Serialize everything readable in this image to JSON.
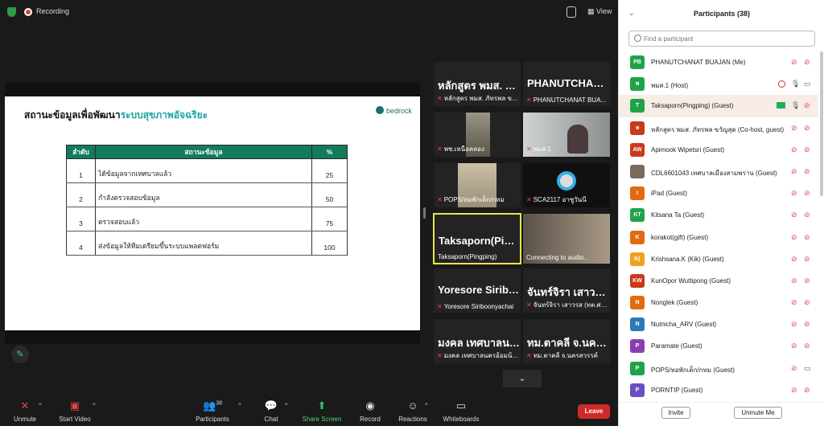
{
  "topbar": {
    "recording_label": "Recording",
    "view_label": "View"
  },
  "slide": {
    "title_black": "สถานะข้อมูลเพื่อพัฒนา",
    "title_teal": "ระบบสุขภาพอัจฉริยะ",
    "logo": "bedrock",
    "headers": [
      "ลำดับ",
      "สถานะข้อมูล",
      "%"
    ],
    "rows": [
      [
        "1",
        "ได้ข้อมูลจากเทศบาลแล้ว",
        "25"
      ],
      [
        "2",
        "กำลังตรวจสอบข้อมูล",
        "50"
      ],
      [
        "3",
        "ตรวจสอบแล้ว",
        "75"
      ],
      [
        "4",
        "ส่งข้อมูลให้ทีมเตรียมขึ้นระบบแพลตฟอร์ม",
        "100"
      ]
    ]
  },
  "tiles": [
    {
      "big": "หลักสูตร พมส. ภั...",
      "name": "หลักสูตร พมส. ภัทรพล ขา..."
    },
    {
      "big": "PHANUTCHAN...",
      "name": "PHANUTCHANAT BUA..."
    },
    {
      "big": "",
      "name": "พช.เหนือคลอง"
    },
    {
      "big": "",
      "name": "พมส.1"
    },
    {
      "big": "",
      "name": "POPS/หอพักเด็ก/กทม"
    },
    {
      "big": "",
      "name": "SCA2117 อาซูวันนี"
    },
    {
      "big": "Taksaporn(Ping...",
      "name": "Taksaporn(Pingping)"
    },
    {
      "big": "",
      "name": "Connecting to audio..."
    },
    {
      "big": "Yoresore Siribo...",
      "name": "Yoresore Siriboonyachai"
    },
    {
      "big": "จันทร์จิรา เสาวรส...",
      "name": "จันทร์จิรา เสาวรส (ทต.ศรีด..."
    },
    {
      "big": "มงคล เทศบาลนค...",
      "name": "มงคล เทศบาลนครอ้อมน้อย"
    },
    {
      "big": "ทม.ตาคลี จ.นครส...",
      "name": "ทม.ตาคลี จ.นครสวรรค์"
    }
  ],
  "toolbar": {
    "unmute": "Unmute",
    "start_video": "Start Video",
    "participants": "Participants",
    "participants_count": "38",
    "chat": "Chat",
    "share_screen": "Share Screen",
    "record": "Record",
    "reactions": "Reactions",
    "whiteboards": "Whiteboards",
    "leave": "Leave"
  },
  "panel": {
    "title": "Participants (38)",
    "search_placeholder": "Find a participant",
    "invite": "Invite",
    "unmute_me": "Unmute Me",
    "participants": [
      {
        "initials": "PB",
        "color": "#1fa34a",
        "name": "PHANUTCHANAT BUAJAN (Me)"
      },
      {
        "initials": "พ",
        "color": "#1fa34a",
        "name": "พมส.1 (Host)"
      },
      {
        "initials": "T",
        "color": "#1fa34a",
        "name": "Taksaporn(Pingping) (Guest)"
      },
      {
        "initials": "ห",
        "color": "#c93a1a",
        "name": "หลักสูตร พมส. ภัทรพล ขวัญสุด (Co-host, guest)"
      },
      {
        "initials": "AW",
        "color": "#c93a1a",
        "name": "Apimook Wipetsri (Guest)"
      },
      {
        "initials": "",
        "color": "#7a6a5a",
        "name": "CDL6601043 เทศบาลเมืองสามพราน (Guest)"
      },
      {
        "initials": "I",
        "color": "#e36a10",
        "name": "iPad (Guest)"
      },
      {
        "initials": "KT",
        "color": "#1fa34a",
        "name": "Kitsana Ta (Guest)"
      },
      {
        "initials": "K",
        "color": "#e36a10",
        "name": "korakot(gift) (Guest)"
      },
      {
        "initials": "K(",
        "color": "#f0a020",
        "name": "Krishsana.K (Kik) (Guest)"
      },
      {
        "initials": "KW",
        "color": "#c93a1a",
        "name": "KunOpor Wuttipong (Guest)"
      },
      {
        "initials": "N",
        "color": "#e36a10",
        "name": "Nonglek (Guest)"
      },
      {
        "initials": "N",
        "color": "#2a7ab8",
        "name": "Nutnicha_ARV (Guest)"
      },
      {
        "initials": "P",
        "color": "#8a3fb0",
        "name": "Paramate (Guest)"
      },
      {
        "initials": "P",
        "color": "#1fa34a",
        "name": "POPS/หอพักเด็ก/กทม (Guest)"
      },
      {
        "initials": "P",
        "color": "#6a4fc0",
        "name": "PORNTIP (Guest)"
      }
    ]
  }
}
